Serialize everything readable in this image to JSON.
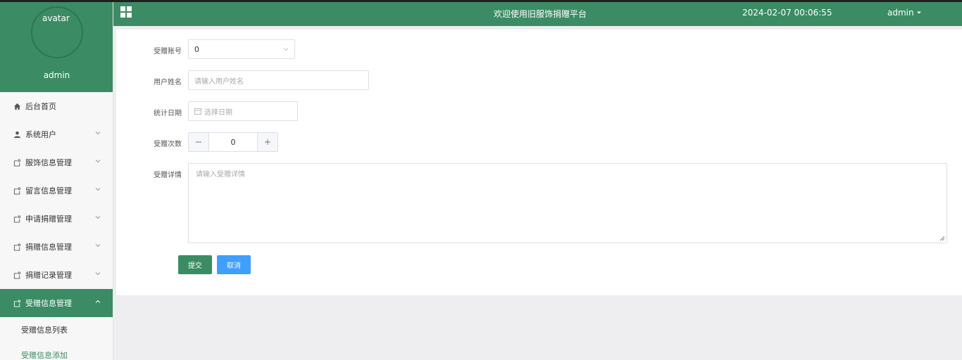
{
  "sidebar": {
    "avatar_text": "avatar",
    "username": "admin",
    "items": [
      {
        "label": "后台首页",
        "icon": "home-icon"
      },
      {
        "label": "系统用户",
        "icon": "user-icon"
      },
      {
        "label": "服饰信息管理",
        "icon": "doc-icon"
      },
      {
        "label": "留言信息管理",
        "icon": "doc-icon"
      },
      {
        "label": "申请捐赠管理",
        "icon": "doc-icon"
      },
      {
        "label": "捐赠信息管理",
        "icon": "doc-icon"
      },
      {
        "label": "捐赠记录管理",
        "icon": "doc-icon"
      },
      {
        "label": "受赠信息管理",
        "icon": "doc-icon"
      }
    ],
    "submenu": [
      {
        "label": "受赠信息列表"
      },
      {
        "label": "受赠信息添加"
      }
    ]
  },
  "header": {
    "title": "欢迎使用旧服饰捐赠平台",
    "datetime": "2024-02-07 00:06:55",
    "user": "admin"
  },
  "form": {
    "account_label": "受赠账号",
    "account_value": "0",
    "name_label": "用户姓名",
    "name_placeholder": "请输入用户姓名",
    "date_label": "统计日期",
    "date_placeholder": "选择日期",
    "count_label": "受赠次数",
    "count_value": "0",
    "detail_label": "受赠详情",
    "detail_placeholder": "请输入受赠详情",
    "submit_label": "提交",
    "cancel_label": "取消"
  },
  "colors": {
    "brand_green": "#3b8c64",
    "cancel_blue": "#409eff"
  }
}
